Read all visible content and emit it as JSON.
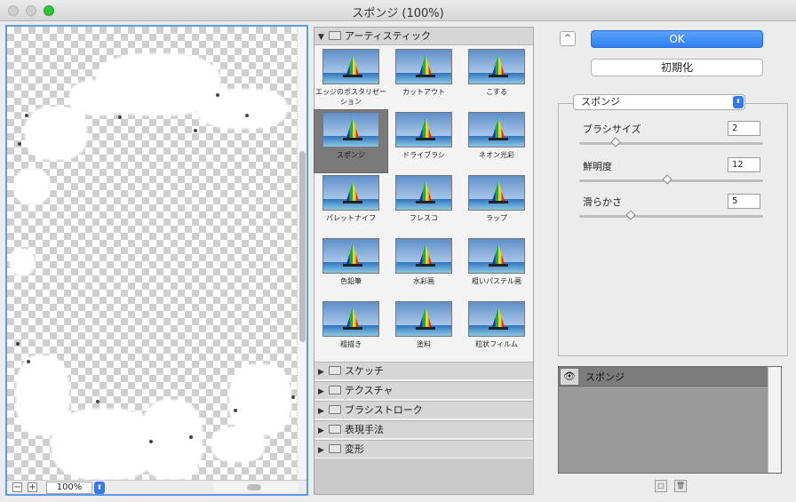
{
  "window": {
    "title": "スポンジ (100%)"
  },
  "preview": {
    "zoom": "100%",
    "zoom_out": "−",
    "zoom_in": "+"
  },
  "gallery": {
    "open_category": "アーティスティック",
    "filters": [
      {
        "label": "エッジのポスタリゼーション"
      },
      {
        "label": "カットアウト"
      },
      {
        "label": "こする"
      },
      {
        "label": "スポンジ",
        "selected": true
      },
      {
        "label": "ドライブラシ"
      },
      {
        "label": "ネオン光彩"
      },
      {
        "label": "パレットナイフ"
      },
      {
        "label": "フレスコ"
      },
      {
        "label": "ラップ"
      },
      {
        "label": "色鉛筆"
      },
      {
        "label": "水彩画"
      },
      {
        "label": "粗いパステル画"
      },
      {
        "label": "粗描き"
      },
      {
        "label": "塗料"
      },
      {
        "label": "粒状フィルム"
      }
    ],
    "categories": [
      "スケッチ",
      "テクスチャ",
      "ブラシストローク",
      "表現手法",
      "変形"
    ]
  },
  "controls": {
    "collapse": "^",
    "ok": "OK",
    "reset": "初期化",
    "filter_select": "スポンジ",
    "params": [
      {
        "label": "ブラシサイズ",
        "value": "2",
        "level": 0.2
      },
      {
        "label": "鮮明度",
        "value": "12",
        "level": 0.48
      },
      {
        "label": "滑らかさ",
        "value": "5",
        "level": 0.28
      }
    ]
  },
  "layers": {
    "items": [
      {
        "name": "スポンジ"
      }
    ]
  }
}
